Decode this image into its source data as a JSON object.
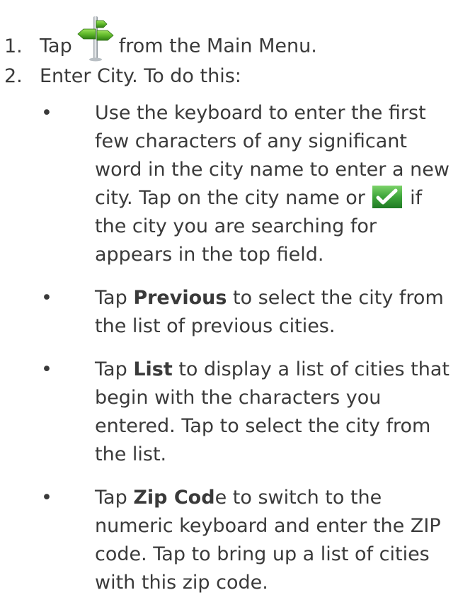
{
  "steps": [
    {
      "number": "1.",
      "text_before": "Tap",
      "icon": "signpost-icon",
      "text_after": "from the Main Menu."
    },
    {
      "number": "2.",
      "text": "Enter City. To do this:"
    }
  ],
  "bullet_char": "•",
  "bullets": [
    {
      "part1": "Use the keyboard to enter the first few characters of any significant word in the city name to enter a new city. Tap on the city name or",
      "icon": "checkmark-icon",
      "part2": "if the city you are searching for appears in the top field."
    },
    {
      "prefix": "Tap",
      "bold": "Previous",
      "suffix": "to select the city from the list of previous cities."
    },
    {
      "prefix": "Tap",
      "bold": "List",
      "suffix": "to display a list of cities that begin with the characters you entered. Tap to select the city from the list."
    },
    {
      "prefix": "Tap",
      "bold": "Zip Cod",
      "bold_tail": "e",
      "suffix": "to switch to the numeric keyboard and enter the ZIP code. Tap to bring up a list of cities with this zip code."
    }
  ],
  "colors": {
    "text": "#3a3a3a",
    "signpost_green": "#5fb82a",
    "signpost_pole": "#c9cfd4",
    "check_green": "#3ea53a"
  }
}
